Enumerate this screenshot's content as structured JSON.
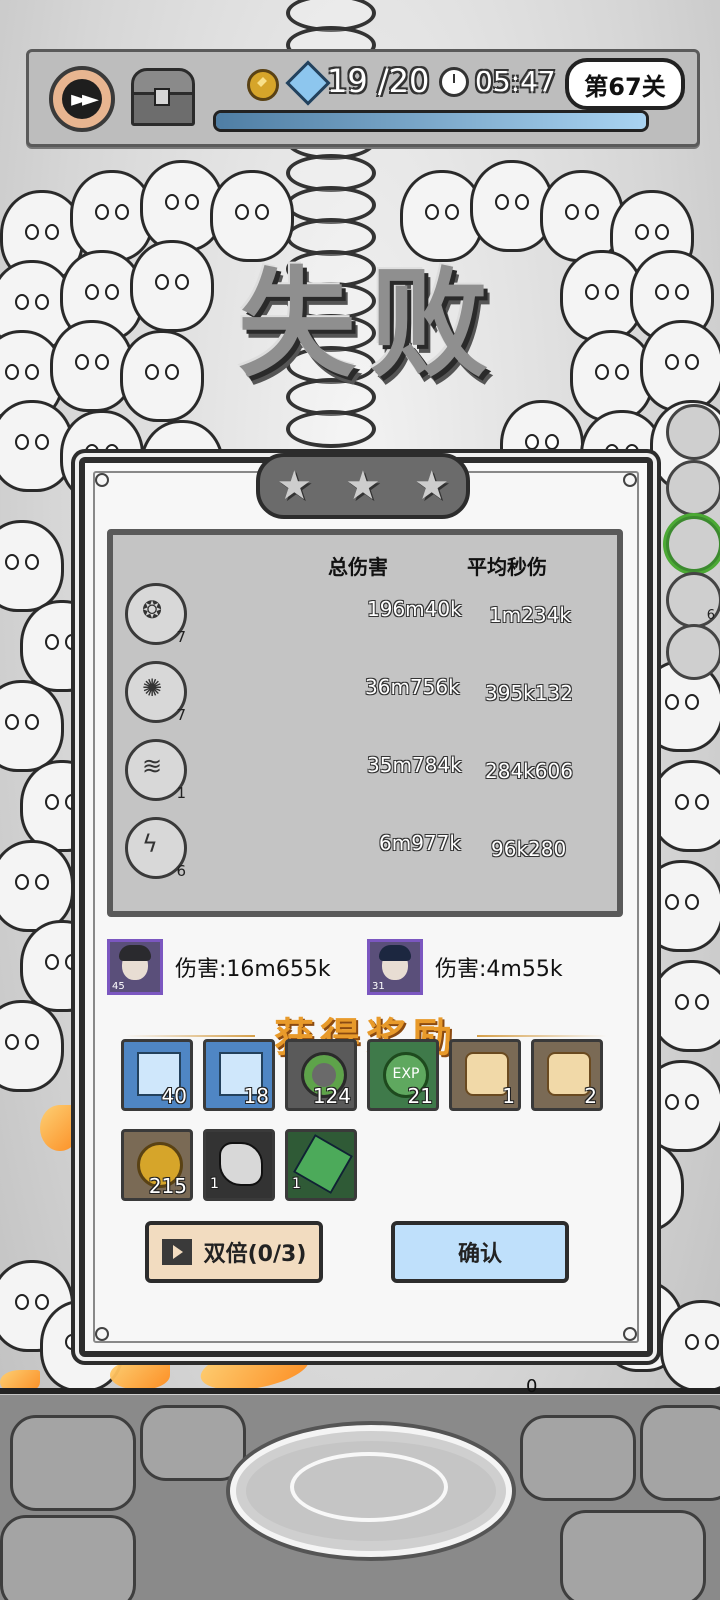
{
  "top_bar": {
    "energy": "19 /20",
    "timer": "05:47",
    "level": "第67关",
    "progress": 1.0
  },
  "result": {
    "banner": "失败",
    "stars": [
      "★",
      "★",
      "★"
    ],
    "headers": {
      "total_damage": "总伤害",
      "avg_dps": "平均秒伤"
    },
    "rows": [
      {
        "icon": "drop-skill-icon",
        "level": "7",
        "total": "196m40k",
        "dps": "1m234k"
      },
      {
        "icon": "crystal-skill-icon",
        "level": "7",
        "total": "36m756k",
        "dps": "395k132"
      },
      {
        "icon": "spring-skill-icon",
        "level": "1",
        "total": "35m784k",
        "dps": "284k606"
      },
      {
        "icon": "lightning-skill-icon",
        "level": "6",
        "total": "6m977k",
        "dps": "96k280"
      }
    ],
    "heroes": [
      {
        "level": "45",
        "damage": "伤害:16m655k"
      },
      {
        "level": "31",
        "damage": "伤害:4m55k"
      }
    ],
    "rewards_title": "获得奖励",
    "rewards": [
      {
        "icon": "tornado-card-icon",
        "qty": "40"
      },
      {
        "icon": "spring-card-icon",
        "qty": "18"
      },
      {
        "icon": "leaf-token-icon",
        "qty": "124"
      },
      {
        "icon": "exp-orb-icon",
        "qty": "21"
      },
      {
        "icon": "scroll-icon",
        "qty": "1"
      },
      {
        "icon": "scroll-fire-icon",
        "qty": "2"
      },
      {
        "icon": "gold-coin-icon",
        "qty": "215"
      },
      {
        "icon": "stone-ore-icon",
        "qty": "1"
      },
      {
        "icon": "green-crystal-icon",
        "qty": "1"
      }
    ],
    "exp_label": "EXP",
    "double_button": "双倍(0/3)",
    "confirm_button": "确认"
  },
  "side_skills": [
    {
      "icon": "drop-skill-icon",
      "level": ""
    },
    {
      "icon": "crystal-skill-icon",
      "level": ""
    },
    {
      "icon": "spring-skill-icon",
      "level": ""
    },
    {
      "icon": "lightning-skill-icon",
      "level": "6"
    },
    {
      "icon": "empty-slot-icon",
      "level": ""
    }
  ],
  "baseline_counter": "0",
  "colors": {
    "reward_title": "#e89a2a",
    "confirm_button": "#bfe0fb",
    "double_button": "#f2dcc0",
    "hero_frame": "#7b57c0"
  }
}
